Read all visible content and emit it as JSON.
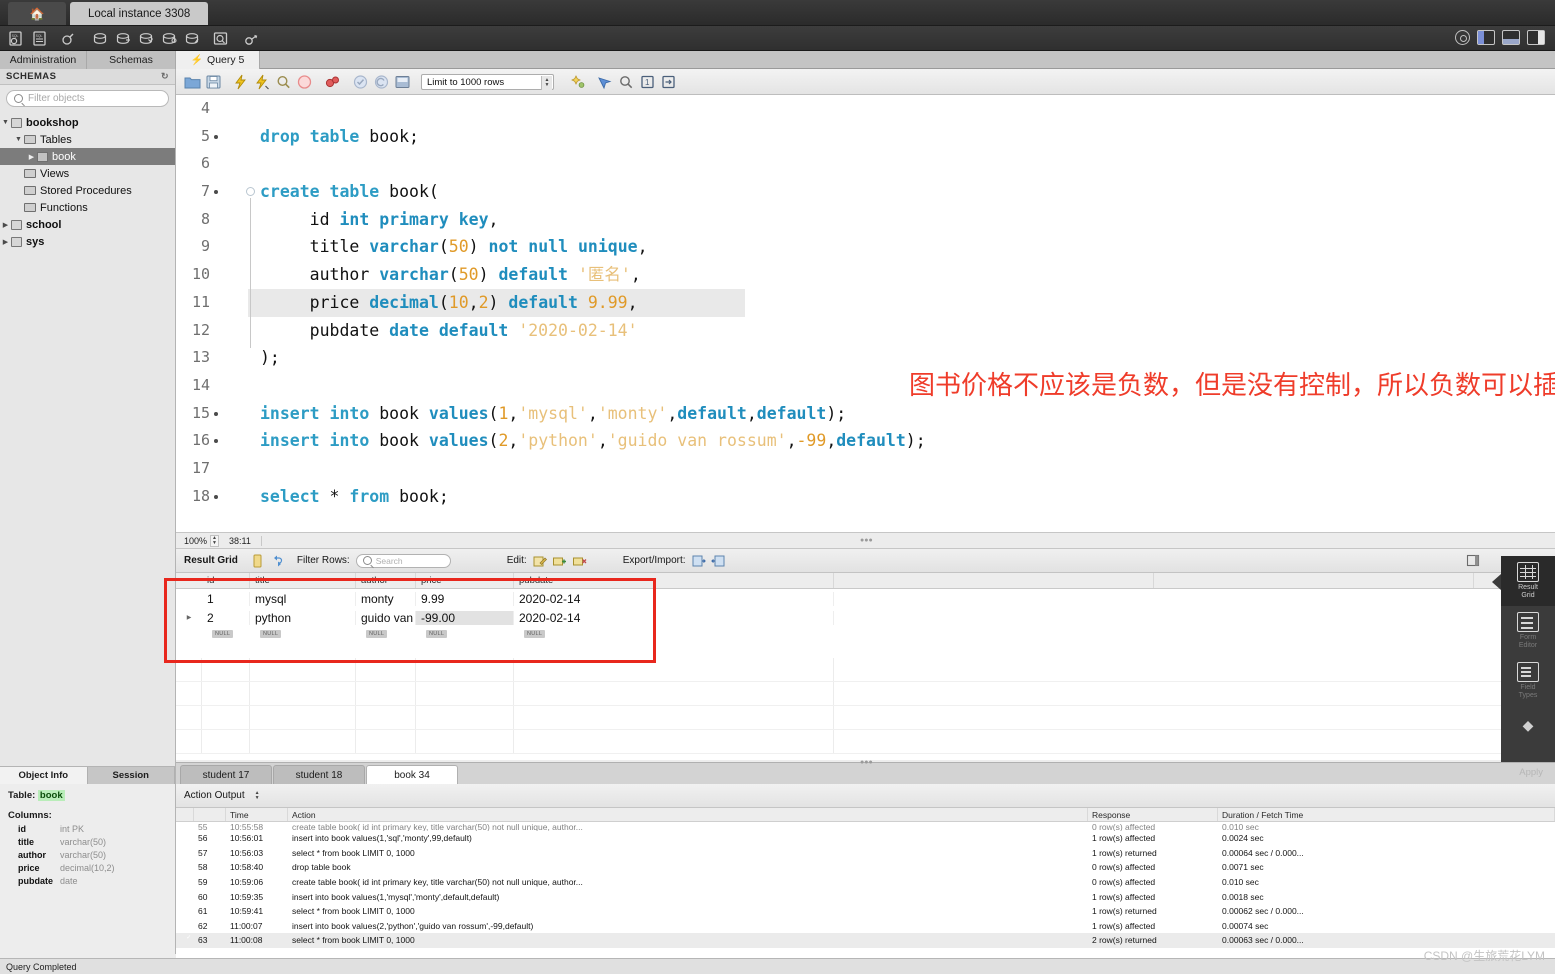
{
  "titlebar": {
    "home_icon": "home-icon",
    "instance_tab": "Local instance 3308"
  },
  "main_toolbar": {
    "icons": [
      "new-sql-tab-icon",
      "open-sql-script-icon",
      "open-connection-icon",
      "new-schema-icon",
      "new-table-icon",
      "new-view-icon",
      "new-procedure-icon",
      "new-function-icon",
      "search-data-icon",
      "reconnect-server-icon"
    ],
    "window_controls": [
      "sidebar-toggle-icon",
      "output-panel-toggle-icon",
      "secondary-sidebar-toggle-icon"
    ],
    "gear_label": "gear-icon"
  },
  "tabs": {
    "administration": "Administration",
    "schemas": "Schemas",
    "query": "Query 5"
  },
  "sidebar": {
    "header": "SCHEMAS",
    "filter_placeholder": "Filter objects",
    "tree": [
      {
        "label": "bookshop",
        "depth": 0,
        "expanded": true,
        "kind": "schema",
        "selected": false
      },
      {
        "label": "Tables",
        "depth": 1,
        "expanded": true,
        "kind": "folder",
        "selected": false
      },
      {
        "label": "book",
        "depth": 2,
        "expanded": false,
        "kind": "table",
        "selected": true
      },
      {
        "label": "Views",
        "depth": 1,
        "expanded": null,
        "kind": "folder",
        "selected": false
      },
      {
        "label": "Stored Procedures",
        "depth": 1,
        "expanded": null,
        "kind": "folder",
        "selected": false
      },
      {
        "label": "Functions",
        "depth": 1,
        "expanded": null,
        "kind": "folder",
        "selected": false
      },
      {
        "label": "school",
        "depth": 0,
        "expanded": false,
        "kind": "schema",
        "selected": false
      },
      {
        "label": "sys",
        "depth": 0,
        "expanded": false,
        "kind": "schema",
        "selected": false
      }
    ]
  },
  "object_info": {
    "tab_object": "Object Info",
    "tab_session": "Session",
    "table_label": "Table:",
    "table_name": "book",
    "columns_label": "Columns:",
    "columns": [
      {
        "name": "id",
        "type": "int PK"
      },
      {
        "name": "title",
        "type": "varchar(50)"
      },
      {
        "name": "author",
        "type": "varchar(50)"
      },
      {
        "name": "price",
        "type": "decimal(10,2)"
      },
      {
        "name": "pubdate",
        "type": "date"
      }
    ]
  },
  "editor_toolbar": {
    "icons": [
      "open-file-icon",
      "save-file-icon",
      "execute-icon",
      "execute-current-icon",
      "explain-icon",
      "stop-icon",
      "toggle-breakpoint-icon",
      "commit-icon",
      "rollback-icon",
      "autocommit-icon",
      "beautify-icon",
      "find-icon",
      "toggle-invisible-icon",
      "wrap-lines-icon"
    ],
    "limit_value": "Limit to 1000 rows"
  },
  "editor": {
    "zoom": "100%",
    "cursor_pos": "38:11",
    "lines": [
      {
        "n": 4,
        "bullet": false,
        "marker": false,
        "text": ""
      },
      {
        "n": 5,
        "bullet": true,
        "marker": false,
        "tokens": [
          {
            "t": "drop",
            "c": "kw"
          },
          {
            "t": " ",
            "c": "punc"
          },
          {
            "t": "table",
            "c": "kw"
          },
          {
            "t": " book;",
            "c": "id"
          }
        ]
      },
      {
        "n": 6,
        "bullet": false,
        "marker": false,
        "text": ""
      },
      {
        "n": 7,
        "bullet": true,
        "marker": true,
        "tokens": [
          {
            "t": "create",
            "c": "kw"
          },
          {
            "t": " ",
            "c": "punc"
          },
          {
            "t": "table",
            "c": "kw"
          },
          {
            "t": " book(",
            "c": "id"
          }
        ]
      },
      {
        "n": 8,
        "bullet": false,
        "marker": false,
        "tokens": [
          {
            "t": "     id ",
            "c": "id"
          },
          {
            "t": "int",
            "c": "kw2"
          },
          {
            "t": " ",
            "c": "punc"
          },
          {
            "t": "primary",
            "c": "kw2"
          },
          {
            "t": " ",
            "c": "punc"
          },
          {
            "t": "key",
            "c": "kw2"
          },
          {
            "t": ",",
            "c": "punc"
          }
        ]
      },
      {
        "n": 9,
        "bullet": false,
        "marker": false,
        "tokens": [
          {
            "t": "     title ",
            "c": "id"
          },
          {
            "t": "varchar",
            "c": "kw2"
          },
          {
            "t": "(",
            "c": "punc"
          },
          {
            "t": "50",
            "c": "num"
          },
          {
            "t": ") ",
            "c": "punc"
          },
          {
            "t": "not",
            "c": "kw2"
          },
          {
            "t": " ",
            "c": "punc"
          },
          {
            "t": "null",
            "c": "kw2"
          },
          {
            "t": " ",
            "c": "punc"
          },
          {
            "t": "unique",
            "c": "kw2"
          },
          {
            "t": ",",
            "c": "punc"
          }
        ]
      },
      {
        "n": 10,
        "bullet": false,
        "marker": false,
        "tokens": [
          {
            "t": "     author ",
            "c": "id"
          },
          {
            "t": "varchar",
            "c": "kw2"
          },
          {
            "t": "(",
            "c": "punc"
          },
          {
            "t": "50",
            "c": "num"
          },
          {
            "t": ") ",
            "c": "punc"
          },
          {
            "t": "default",
            "c": "kw2"
          },
          {
            "t": " ",
            "c": "punc"
          },
          {
            "t": "'匿名'",
            "c": "str"
          },
          {
            "t": ",",
            "c": "punc"
          }
        ]
      },
      {
        "n": 11,
        "bullet": false,
        "marker": false,
        "highlight": true,
        "tokens": [
          {
            "t": "     price ",
            "c": "id"
          },
          {
            "t": "decimal",
            "c": "kw2"
          },
          {
            "t": "(",
            "c": "punc"
          },
          {
            "t": "10",
            "c": "num"
          },
          {
            "t": ",",
            "c": "punc"
          },
          {
            "t": "2",
            "c": "num"
          },
          {
            "t": ") ",
            "c": "punc"
          },
          {
            "t": "default",
            "c": "kw2"
          },
          {
            "t": " ",
            "c": "punc"
          },
          {
            "t": "9.99",
            "c": "num"
          },
          {
            "t": ",",
            "c": "punc"
          }
        ]
      },
      {
        "n": 12,
        "bullet": false,
        "marker": false,
        "tokens": [
          {
            "t": "     pubdate ",
            "c": "id"
          },
          {
            "t": "date",
            "c": "kw2"
          },
          {
            "t": " ",
            "c": "punc"
          },
          {
            "t": "default",
            "c": "kw2"
          },
          {
            "t": " ",
            "c": "punc"
          },
          {
            "t": "'2020-02-14'",
            "c": "str"
          }
        ]
      },
      {
        "n": 13,
        "bullet": false,
        "marker": false,
        "tokens": [
          {
            "t": ");",
            "c": "id"
          }
        ]
      },
      {
        "n": 14,
        "bullet": false,
        "marker": false,
        "text": ""
      },
      {
        "n": 15,
        "bullet": true,
        "marker": false,
        "tokens": [
          {
            "t": "insert",
            "c": "kw"
          },
          {
            "t": " ",
            "c": "punc"
          },
          {
            "t": "into",
            "c": "kw"
          },
          {
            "t": " book ",
            "c": "id"
          },
          {
            "t": "values",
            "c": "kw2"
          },
          {
            "t": "(",
            "c": "punc"
          },
          {
            "t": "1",
            "c": "num"
          },
          {
            "t": ",",
            "c": "punc"
          },
          {
            "t": "'mysql'",
            "c": "str"
          },
          {
            "t": ",",
            "c": "punc"
          },
          {
            "t": "'monty'",
            "c": "str"
          },
          {
            "t": ",",
            "c": "punc"
          },
          {
            "t": "default",
            "c": "kw2"
          },
          {
            "t": ",",
            "c": "punc"
          },
          {
            "t": "default",
            "c": "kw2"
          },
          {
            "t": ");",
            "c": "punc"
          }
        ]
      },
      {
        "n": 16,
        "bullet": true,
        "marker": false,
        "tokens": [
          {
            "t": "insert",
            "c": "kw"
          },
          {
            "t": " ",
            "c": "punc"
          },
          {
            "t": "into",
            "c": "kw"
          },
          {
            "t": " book ",
            "c": "id"
          },
          {
            "t": "values",
            "c": "kw2"
          },
          {
            "t": "(",
            "c": "punc"
          },
          {
            "t": "2",
            "c": "num"
          },
          {
            "t": ",",
            "c": "punc"
          },
          {
            "t": "'python'",
            "c": "str"
          },
          {
            "t": ",",
            "c": "punc"
          },
          {
            "t": "'guido van rossum'",
            "c": "str"
          },
          {
            "t": ",",
            "c": "punc"
          },
          {
            "t": "-99",
            "c": "num"
          },
          {
            "t": ",",
            "c": "punc"
          },
          {
            "t": "default",
            "c": "kw2"
          },
          {
            "t": ");",
            "c": "punc"
          }
        ]
      },
      {
        "n": 17,
        "bullet": false,
        "marker": false,
        "text": ""
      },
      {
        "n": 18,
        "bullet": true,
        "marker": false,
        "tokens": [
          {
            "t": "select",
            "c": "kw"
          },
          {
            "t": " ",
            "c": "punc"
          },
          {
            "t": "*",
            "c": "id"
          },
          {
            "t": " ",
            "c": "punc"
          },
          {
            "t": "from",
            "c": "kw"
          },
          {
            "t": " book;",
            "c": "id"
          }
        ]
      }
    ],
    "annotation": "图书价格不应该是负数，但是没有控制，所以负数可以插入",
    "annotation_color": "#ef3c2a",
    "play_button": "run-query-button"
  },
  "result_toolbar": {
    "title": "Result Grid",
    "filter_label": "Filter Rows:",
    "filter_placeholder": "Search",
    "edit_label": "Edit:",
    "export_label": "Export/Import:",
    "icons": [
      "grid-view-icon",
      "refresh-icon",
      "search-icon",
      "edit-row-icon",
      "insert-row-icon",
      "delete-row-icon",
      "export-recordset-icon",
      "import-recordset-icon",
      "wrap-cell-icon"
    ]
  },
  "result_grid": {
    "columns": [
      "id",
      "title",
      "author",
      "price",
      "pubdate"
    ],
    "rows": [
      {
        "selected_marker": false,
        "cells": [
          "1",
          "mysql",
          "monty",
          "9.99",
          "2020-02-14"
        ]
      },
      {
        "selected_marker": true,
        "cells": [
          "2",
          "python",
          "guido van rossum",
          "-99.00",
          "2020-02-14"
        ],
        "highlight_cell": 3
      }
    ],
    "null_row": [
      "NULL",
      "NULL",
      "NULL",
      "NULL",
      "NULL"
    ],
    "highlight_box_color": "#e8271d"
  },
  "right_panel": {
    "items": [
      {
        "label": "Result\nGrid",
        "icon": "result-grid-icon",
        "active": true
      },
      {
        "label": "Form\nEditor",
        "icon": "form-editor-icon",
        "active": false
      },
      {
        "label": "Field\nTypes",
        "icon": "field-types-icon",
        "active": false
      }
    ],
    "chevron": "chevron-down-icon"
  },
  "bottom_tabs": {
    "tabs": [
      {
        "label": "student 17",
        "active": false
      },
      {
        "label": "student 18",
        "active": false
      },
      {
        "label": "book 34",
        "active": true
      }
    ],
    "apply_label": "Apply"
  },
  "action_output": {
    "label": "Action Output",
    "headers": [
      "",
      "Time",
      "Action",
      "Response",
      "Duration / Fetch Time"
    ],
    "rows": [
      {
        "n": "55",
        "time": "10:55:58",
        "action": "create table book( id int primary key,    title varchar(50) not null unique,   author...",
        "response": "0 row(s) affected",
        "duration": "0.010 sec",
        "partial": true
      },
      {
        "n": "56",
        "time": "10:56:01",
        "action": "insert into book values(1,'sql','monty',99,default)",
        "response": "1 row(s) affected",
        "duration": "0.0024 sec"
      },
      {
        "n": "57",
        "time": "10:56:03",
        "action": "select * from book LIMIT 0, 1000",
        "response": "1 row(s) returned",
        "duration": "0.00064 sec / 0.000..."
      },
      {
        "n": "58",
        "time": "10:58:40",
        "action": "drop table book",
        "response": "0 row(s) affected",
        "duration": "0.0071 sec"
      },
      {
        "n": "59",
        "time": "10:59:06",
        "action": "create table book(  id int primary key,    title varchar(50) not null unique,     author...",
        "response": "0 row(s) affected",
        "duration": "0.010 sec"
      },
      {
        "n": "60",
        "time": "10:59:35",
        "action": "insert into book values(1,'mysql','monty',default,default)",
        "response": "1 row(s) affected",
        "duration": "0.0018 sec"
      },
      {
        "n": "61",
        "time": "10:59:41",
        "action": "select * from book LIMIT 0, 1000",
        "response": "1 row(s) returned",
        "duration": "0.00062 sec / 0.000..."
      },
      {
        "n": "62",
        "time": "11:00:07",
        "action": "insert into book values(2,'python','guido van rossum',-99,default)",
        "response": "1 row(s) affected",
        "duration": "0.00074 sec"
      },
      {
        "n": "63",
        "time": "11:00:08",
        "action": "select * from book LIMIT 0, 1000",
        "response": "2 row(s) returned",
        "duration": "0.00063 sec / 0.000...",
        "current": true
      }
    ]
  },
  "status_bar": {
    "text": "Query Completed",
    "watermark": "CSDN @生旅荒花LYM"
  }
}
